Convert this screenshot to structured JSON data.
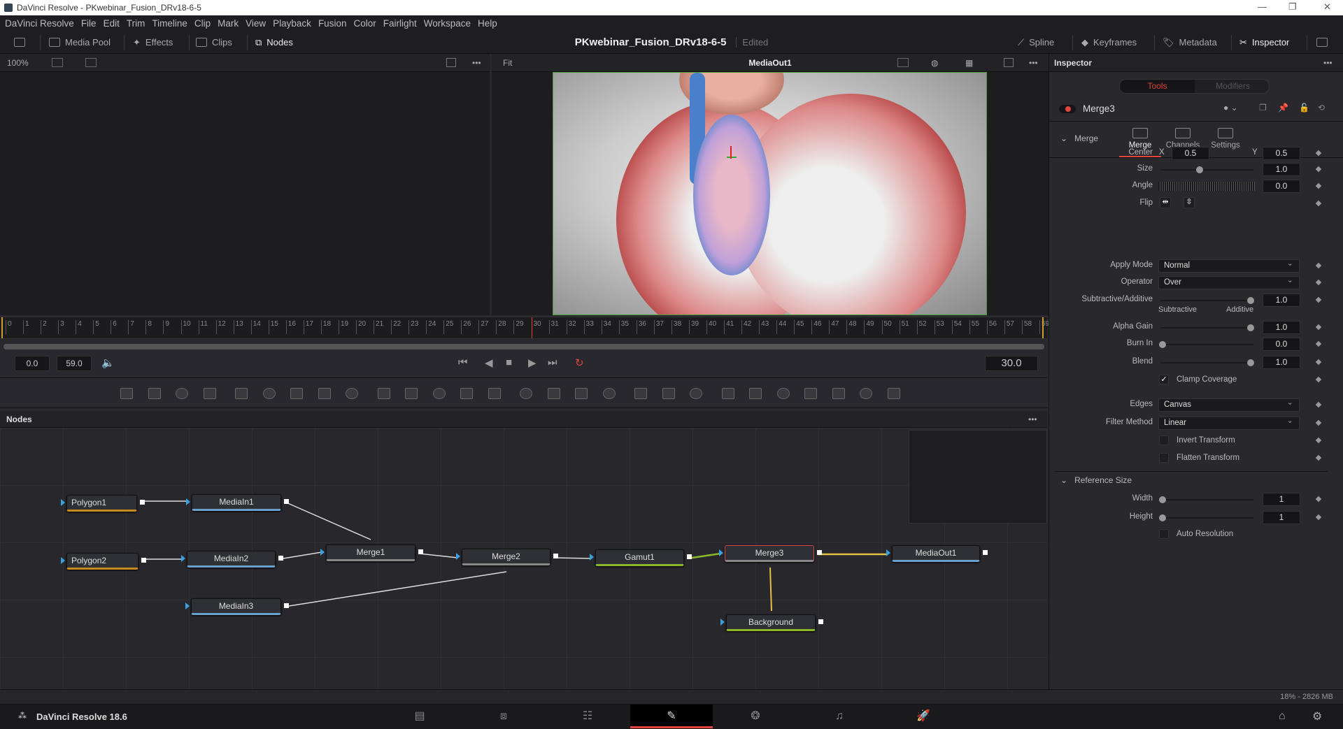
{
  "window": {
    "title": "DaVinci Resolve - PKwebinar_Fusion_DRv18-6-5",
    "min": "—",
    "restore": "❐",
    "close": "✕"
  },
  "menu": [
    "DaVinci Resolve",
    "File",
    "Edit",
    "Trim",
    "Timeline",
    "Clip",
    "Mark",
    "View",
    "Playback",
    "Fusion",
    "Color",
    "Fairlight",
    "Workspace",
    "Help"
  ],
  "toolbar": {
    "media_pool": "Media Pool",
    "effects": "Effects",
    "clips": "Clips",
    "nodes": "Nodes",
    "project": "PKwebinar_Fusion_DRv18-6-5",
    "edited": "Edited",
    "spline": "Spline",
    "keyframes": "Keyframes",
    "metadata": "Metadata",
    "inspector": "Inspector"
  },
  "viewer_left": {
    "zoom": "100%"
  },
  "viewer_right": {
    "fit": "Fit",
    "title": "MediaOut1"
  },
  "timeline": {
    "start": 0,
    "end": 59,
    "playhead": 30,
    "start_field": "0.0",
    "end_field": "59.0",
    "current": "30.0"
  },
  "nodes_panel": {
    "title": "Nodes",
    "more": "•••",
    "nodes": [
      {
        "name": "Polygon1",
        "color": "#c88a20"
      },
      {
        "name": "MediaIn1",
        "color": "#6aa0cc"
      },
      {
        "name": "Polygon2",
        "color": "#c88a20"
      },
      {
        "name": "MediaIn2",
        "color": "#6aa0cc"
      },
      {
        "name": "Merge1",
        "color": "#888888"
      },
      {
        "name": "Merge2",
        "color": "#888888"
      },
      {
        "name": "MediaIn3",
        "color": "#6aa0cc"
      },
      {
        "name": "Gamut1",
        "color": "#8ab828"
      },
      {
        "name": "Merge3",
        "color": "#888888"
      },
      {
        "name": "MediaOut1",
        "color": "#6aa0cc"
      },
      {
        "name": "Background",
        "color": "#8ab828"
      }
    ]
  },
  "status": {
    "memory": "18% - 2826 MB"
  },
  "bottom": {
    "app": "DaVinci Resolve 18.6",
    "pages": [
      "media",
      "cut",
      "edit",
      "fusion",
      "color",
      "fairlight",
      "deliver"
    ],
    "active_page": "fusion"
  },
  "inspector": {
    "title": "Inspector",
    "more": "•••",
    "tab_tools": "Tools",
    "tab_modifiers": "Modifiers",
    "node": "Merge3",
    "subtabs": [
      "Merge",
      "Channels",
      "Settings"
    ],
    "section_merge": "Merge",
    "section_ref": "Reference Size",
    "center": {
      "label": "Center",
      "x_label": "X",
      "x": "0.5",
      "y_label": "Y",
      "y": "0.5"
    },
    "sliders": [
      {
        "label": "Size",
        "value": "1.0",
        "pos": 0.42
      },
      {
        "label": "Angle",
        "value": "0.0"
      },
      {
        "label": "Subtractive/Additive",
        "value": "1.0",
        "pos": 1.0
      },
      {
        "label": "Alpha Gain",
        "value": "1.0",
        "pos": 1.0
      },
      {
        "label": "Burn In",
        "value": "0.0",
        "pos": 0.0
      },
      {
        "label": "Blend",
        "value": "1.0",
        "pos": 1.0
      },
      {
        "label": "Width",
        "value": "1",
        "pos": 0.0
      },
      {
        "label": "Height",
        "value": "1",
        "pos": 0.0
      }
    ],
    "flip": "Flip",
    "sub_left": "Subtractive",
    "sub_right": "Additive",
    "dropdowns": [
      {
        "label": "Apply Mode",
        "value": "Normal"
      },
      {
        "label": "Operator",
        "value": "Over"
      },
      {
        "label": "Edges",
        "value": "Canvas"
      },
      {
        "label": "Filter Method",
        "value": "Linear"
      }
    ],
    "checks": [
      {
        "label": "Clamp Coverage",
        "checked": true
      },
      {
        "label": "Invert Transform",
        "checked": false
      },
      {
        "label": "Flatten Transform",
        "checked": false
      },
      {
        "label": "Auto Resolution",
        "checked": false
      }
    ]
  },
  "colors": {
    "accent": "#e0443c",
    "selected_node": "#d04848"
  }
}
